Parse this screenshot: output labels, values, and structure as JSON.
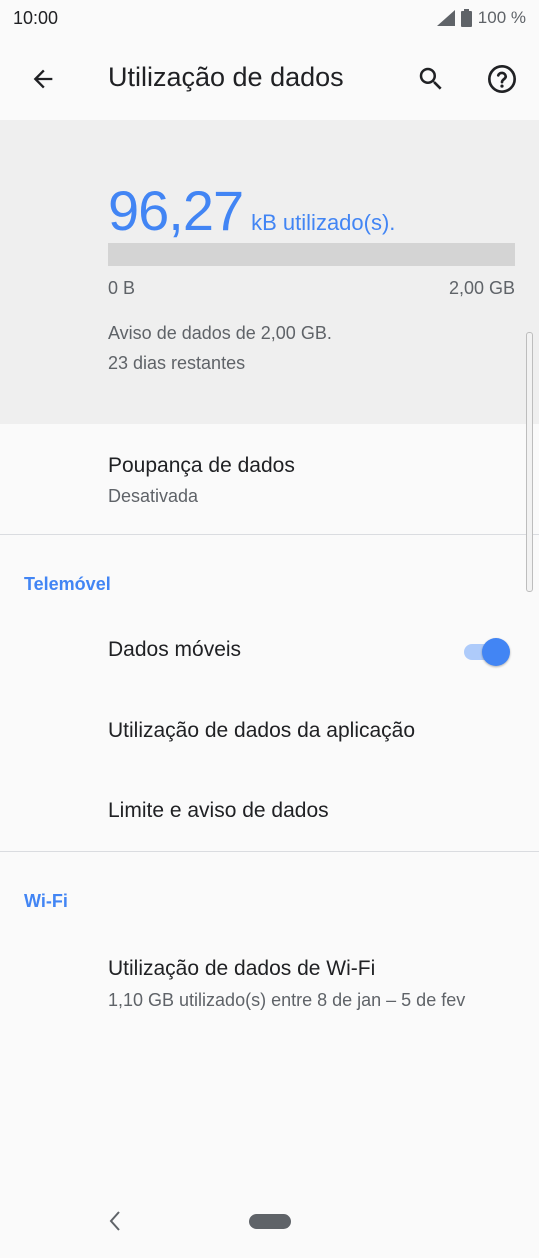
{
  "status_bar": {
    "time": "10:00",
    "battery": "100 %"
  },
  "app_bar": {
    "title": "Utilização de dados"
  },
  "usage": {
    "amount": "96,27",
    "unit": "kB utilizado(s).",
    "bar_min": "0 B",
    "bar_max": "2,00 GB",
    "fill_fraction": 5e-05,
    "warning_line1": "Aviso de dados de 2,00 GB.",
    "warning_line2": "23 dias restantes"
  },
  "data_saver": {
    "title": "Poupança de dados",
    "status": "Desativada"
  },
  "mobile_section": {
    "header": "Telemóvel",
    "mobile_data_label": "Dados móveis",
    "mobile_data_enabled": true,
    "app_usage_label": "Utilização de dados da aplicação",
    "limit_label": "Limite e aviso de dados"
  },
  "wifi_section": {
    "header": "Wi-Fi",
    "usage_title": "Utilização de dados de Wi-Fi",
    "usage_sub": "1,10 GB utilizado(s) entre 8 de jan – 5 de fev"
  },
  "colors": {
    "accent": "#4285f4",
    "card_bg": "#efefef",
    "bar_bg": "#d4d4d4"
  }
}
